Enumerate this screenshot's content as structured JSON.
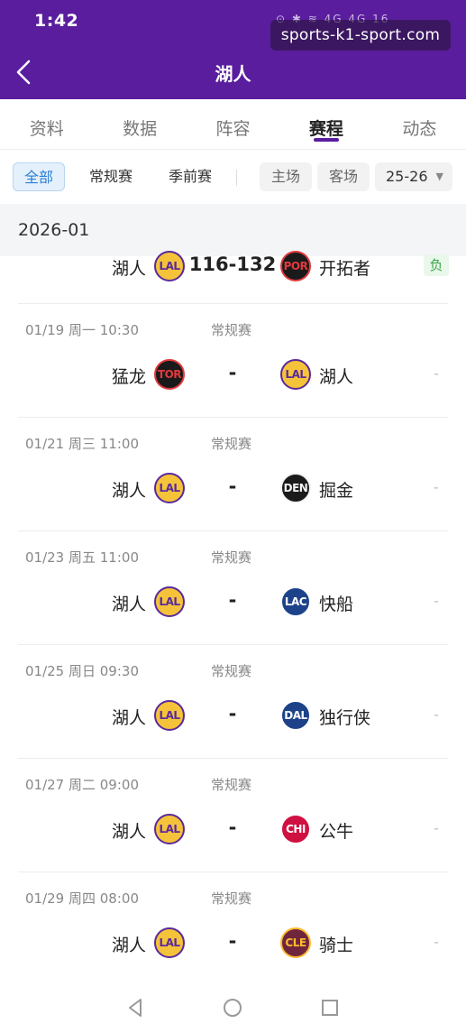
{
  "status": {
    "time": "1:42",
    "icons": "⊙ ✱ ≋ 4G 4G 16"
  },
  "watermark": "sports-k1-sport.com",
  "header": {
    "title": "湖人"
  },
  "tabs": [
    "资料",
    "数据",
    "阵容",
    "赛程",
    "动态"
  ],
  "active_tab": 3,
  "filters": {
    "all": "全部",
    "regular": "常规赛",
    "preseason": "季前赛",
    "home": "主场",
    "away": "客场",
    "season": "25-26"
  },
  "month": "2026-01",
  "games": [
    {
      "date": "",
      "type": "",
      "home": "湖人",
      "home_abbr": "LAL",
      "score": "116-132",
      "away": "开拓者",
      "away_abbr": "POR",
      "result": "负"
    },
    {
      "date": "01/19  周一 10:30",
      "type": "常规赛",
      "home": "猛龙",
      "home_abbr": "TOR",
      "score": "-",
      "away": "湖人",
      "away_abbr": "LAL",
      "result": "-"
    },
    {
      "date": "01/21  周三 11:00",
      "type": "常规赛",
      "home": "湖人",
      "home_abbr": "LAL",
      "score": "-",
      "away": "掘金",
      "away_abbr": "DEN",
      "result": "-"
    },
    {
      "date": "01/23  周五 11:00",
      "type": "常规赛",
      "home": "湖人",
      "home_abbr": "LAL",
      "score": "-",
      "away": "快船",
      "away_abbr": "LAC",
      "result": "-"
    },
    {
      "date": "01/25  周日 09:30",
      "type": "常规赛",
      "home": "湖人",
      "home_abbr": "LAL",
      "score": "-",
      "away": "独行侠",
      "away_abbr": "DAL",
      "result": "-"
    },
    {
      "date": "01/27  周二 09:00",
      "type": "常规赛",
      "home": "湖人",
      "home_abbr": "LAL",
      "score": "-",
      "away": "公牛",
      "away_abbr": "CHI",
      "result": "-"
    },
    {
      "date": "01/29  周四 08:00",
      "type": "常规赛",
      "home": "湖人",
      "home_abbr": "LAL",
      "score": "-",
      "away": "骑士",
      "away_abbr": "CLE",
      "result": "-"
    }
  ],
  "team_colors": {
    "LAL": {
      "bg": "#f5c33a",
      "fg": "#5a2a9b"
    },
    "POR": {
      "bg": "#1a1a1a",
      "fg": "#e03a3e"
    },
    "TOR": {
      "bg": "#1a1a1a",
      "fg": "#e03a3e"
    },
    "DEN": {
      "bg": "#1a1a1a",
      "fg": "#f2f2f2"
    },
    "LAC": {
      "bg": "#1d428a",
      "fg": "#ffffff"
    },
    "DAL": {
      "bg": "#1d428a",
      "fg": "#ffffff"
    },
    "CHI": {
      "bg": "#ce1141",
      "fg": "#ffffff"
    },
    "CLE": {
      "bg": "#6f263d",
      "fg": "#fdbb30"
    }
  },
  "accent_color": "#5a1d9e"
}
